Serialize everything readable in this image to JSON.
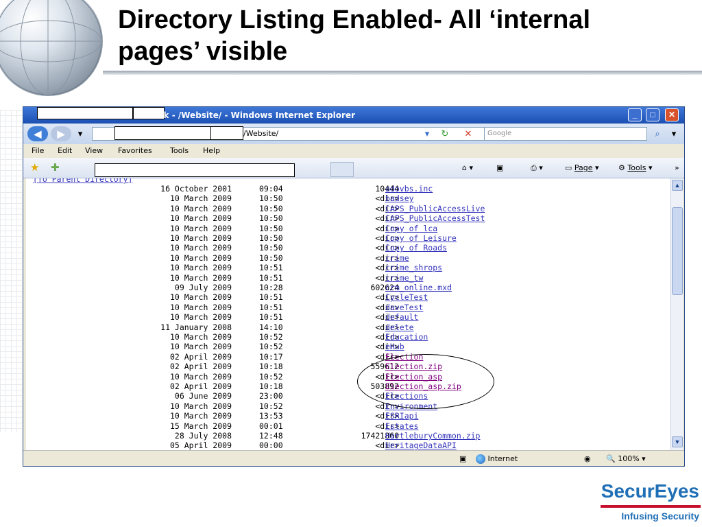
{
  "slide": {
    "title_line1": "Directory Listing Enabled- All ‘internal",
    "title_line2": "pages’ visible"
  },
  "browser": {
    "title_text": "uk - /Website/ - Windows Internet Explorer",
    "address_text": "/Website/",
    "search_placeholder": "Google",
    "menu": [
      "File",
      "Edit",
      "View",
      "Favorites",
      "Tools",
      "Help"
    ],
    "toolbar": {
      "page_label": "Page",
      "tools_label": "Tools"
    },
    "status": {
      "zone": "Internet",
      "zoom": "100%"
    }
  },
  "listing": {
    "parent_link": "[To Parent Directory]",
    "rows": [
      {
        "date": "16 October 2001",
        "time": "09:04",
        "size": "10444",
        "name": "adovbs.inc"
      },
      {
        "date": "10 March 2009",
        "time": "10:50",
        "size": "<dir>",
        "name": "badsey"
      },
      {
        "date": "10 March 2009",
        "time": "10:50",
        "size": "<dir>",
        "name": "CAPS_PublicAccessLive"
      },
      {
        "date": "10 March 2009",
        "time": "10:50",
        "size": "<dir>",
        "name": "CAPS_PublicAccessTest"
      },
      {
        "date": "10 March 2009",
        "time": "10:50",
        "size": "<dir>",
        "name": "Copy of lca"
      },
      {
        "date": "10 March 2009",
        "time": "10:50",
        "size": "<dir>",
        "name": "Copy of Leisure"
      },
      {
        "date": "10 March 2009",
        "time": "10:50",
        "size": "<dir>",
        "name": "Copy of Roads"
      },
      {
        "date": "10 March 2009",
        "time": "10:50",
        "size": "<dir>",
        "name": "crime"
      },
      {
        "date": "10 March 2009",
        "time": "10:51",
        "size": "<dir>",
        "name": "crime_shrops"
      },
      {
        "date": "10 March 2009",
        "time": "10:51",
        "size": "<dir>",
        "name": "crime_tw"
      },
      {
        "date": "09 July 2009",
        "time": "10:28",
        "size": "602624",
        "name": "crm_online.mxd"
      },
      {
        "date": "10 March 2009",
        "time": "10:51",
        "size": "<dir>",
        "name": "CycleTest"
      },
      {
        "date": "10 March 2009",
        "time": "10:51",
        "size": "<dir>",
        "name": "daveTest"
      },
      {
        "date": "10 March 2009",
        "time": "10:51",
        "size": "<dir>",
        "name": "default"
      },
      {
        "date": "11 January 2008",
        "time": "14:10",
        "size": "<dir>",
        "name": "delete"
      },
      {
        "date": "10 March 2009",
        "time": "10:52",
        "size": "<dir>",
        "name": "Education"
      },
      {
        "date": "10 March 2009",
        "time": "10:52",
        "size": "<dir>",
        "name": "eHub"
      },
      {
        "date": "02 April 2009",
        "time": "10:17",
        "size": "<dir>",
        "name": "Election",
        "visited": true
      },
      {
        "date": "02 April 2009",
        "time": "10:18",
        "size": "559612",
        "name": "Election.zip",
        "visited": true
      },
      {
        "date": "10 March 2009",
        "time": "10:52",
        "size": "<dir>",
        "name": "Election_asp",
        "visited": true
      },
      {
        "date": "02 April 2009",
        "time": "10:18",
        "size": "503892",
        "name": "Election_asp.zip",
        "visited": true
      },
      {
        "date": "06 June 2009",
        "time": "23:00",
        "size": "<dir>",
        "name": "Elections"
      },
      {
        "date": "10 March 2009",
        "time": "10:52",
        "size": "<dir>",
        "name": "Environment"
      },
      {
        "date": "10 March 2009",
        "time": "13:53",
        "size": "<dir>",
        "name": "ESRIapi"
      },
      {
        "date": "15 March 2009",
        "time": "00:01",
        "size": "<dir>",
        "name": "Estates"
      },
      {
        "date": "28 July 2008",
        "time": "12:48",
        "size": "17421860",
        "name": "HartleburyCommon.zip"
      },
      {
        "date": "05 April 2009",
        "time": "00:00",
        "size": "<dir>",
        "name": "HeritageDataAPI"
      }
    ]
  },
  "logo": {
    "name": "SecurEyes",
    "tagline": "Infusing Security"
  }
}
